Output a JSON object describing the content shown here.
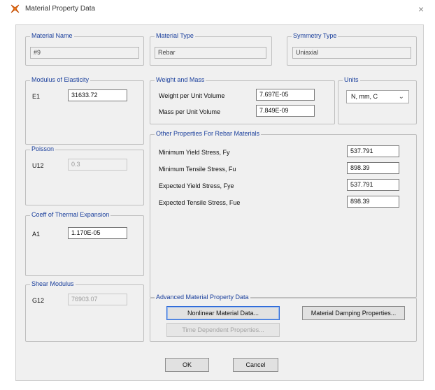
{
  "window": {
    "title": "Material Property Data",
    "close_glyph": "×"
  },
  "material_name": {
    "title": "Material Name",
    "value": "#9"
  },
  "material_type": {
    "title": "Material Type",
    "value": "Rebar"
  },
  "symmetry_type": {
    "title": "Symmetry Type",
    "value": "Uniaxial"
  },
  "modulus": {
    "title": "Modulus of Elasticity",
    "label": "E1",
    "value": "31633.72"
  },
  "weight_mass": {
    "title": "Weight and Mass",
    "weight_label": "Weight per Unit Volume",
    "weight_value": "7.697E-05",
    "mass_label": "Mass per Unit Volume",
    "mass_value": "7.849E-09"
  },
  "units": {
    "title": "Units",
    "selected": "N, mm, C",
    "arrow": "⌄"
  },
  "poisson": {
    "title": "Poisson",
    "label": "U12",
    "value": "0.3"
  },
  "rebar_props": {
    "title": "Other Properties For Rebar Materials",
    "rows": [
      {
        "label": "Minimum Yield Stress, Fy",
        "value": "537.791"
      },
      {
        "label": "Minimum Tensile Stress, Fu",
        "value": "898.39"
      },
      {
        "label": "Expected Yield Stress, Fye",
        "value": "537.791"
      },
      {
        "label": "Expected Tensile Stress, Fue",
        "value": "898.39"
      }
    ]
  },
  "thermal": {
    "title": "Coeff of Thermal Expansion",
    "label": "A1",
    "value": "1.170E-05"
  },
  "shear": {
    "title": "Shear Modulus",
    "label": "G12",
    "value": "76903.07"
  },
  "advanced": {
    "title": "Advanced Material Property Data",
    "nonlinear_label": "Nonlinear Material Data...",
    "damping_label": "Material Damping Properties...",
    "time_dep_label": "Time Dependent Properties..."
  },
  "footer": {
    "ok_label": "OK",
    "cancel_label": "Cancel"
  },
  "colors": {
    "group_title": "#1a3f9c",
    "panel_bg": "#f0f0f0",
    "primary_border": "#2f6bd8"
  }
}
